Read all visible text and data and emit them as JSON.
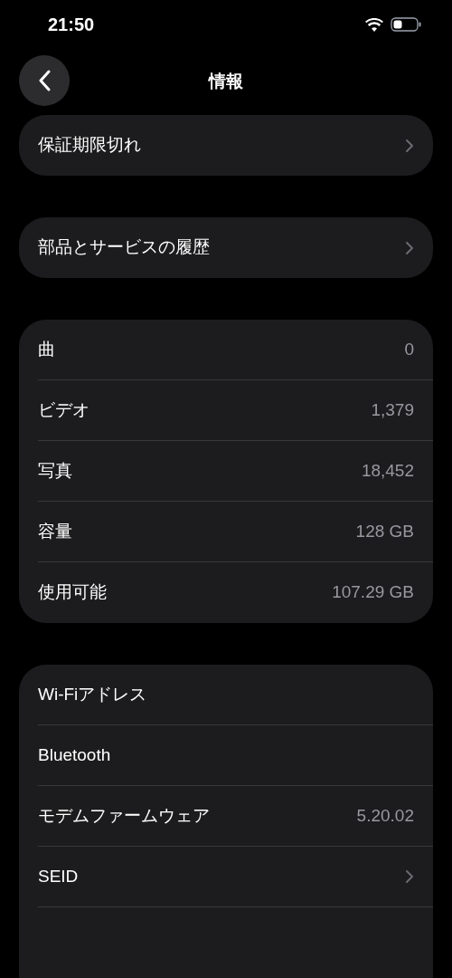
{
  "status_bar": {
    "time": "21:50"
  },
  "nav": {
    "title": "情報"
  },
  "groups": [
    {
      "rows": [
        {
          "kind": "link",
          "label": "保証期限切れ"
        }
      ]
    },
    {
      "rows": [
        {
          "kind": "link",
          "label": "部品とサービスの履歴"
        }
      ]
    },
    {
      "rows": [
        {
          "kind": "value",
          "label": "曲",
          "value": "0"
        },
        {
          "kind": "value",
          "label": "ビデオ",
          "value": "1,379"
        },
        {
          "kind": "value",
          "label": "写真",
          "value": "18,452"
        },
        {
          "kind": "value",
          "label": "容量",
          "value": "128 GB"
        },
        {
          "kind": "value",
          "label": "使用可能",
          "value": "107.29 GB"
        }
      ]
    },
    {
      "rows": [
        {
          "kind": "value",
          "label": "Wi-Fiアドレス"
        },
        {
          "kind": "value",
          "label": "Bluetooth"
        },
        {
          "kind": "value",
          "label": "モデムファームウェア",
          "value": "5.20.02"
        },
        {
          "kind": "link",
          "label": "SEID"
        }
      ]
    }
  ]
}
